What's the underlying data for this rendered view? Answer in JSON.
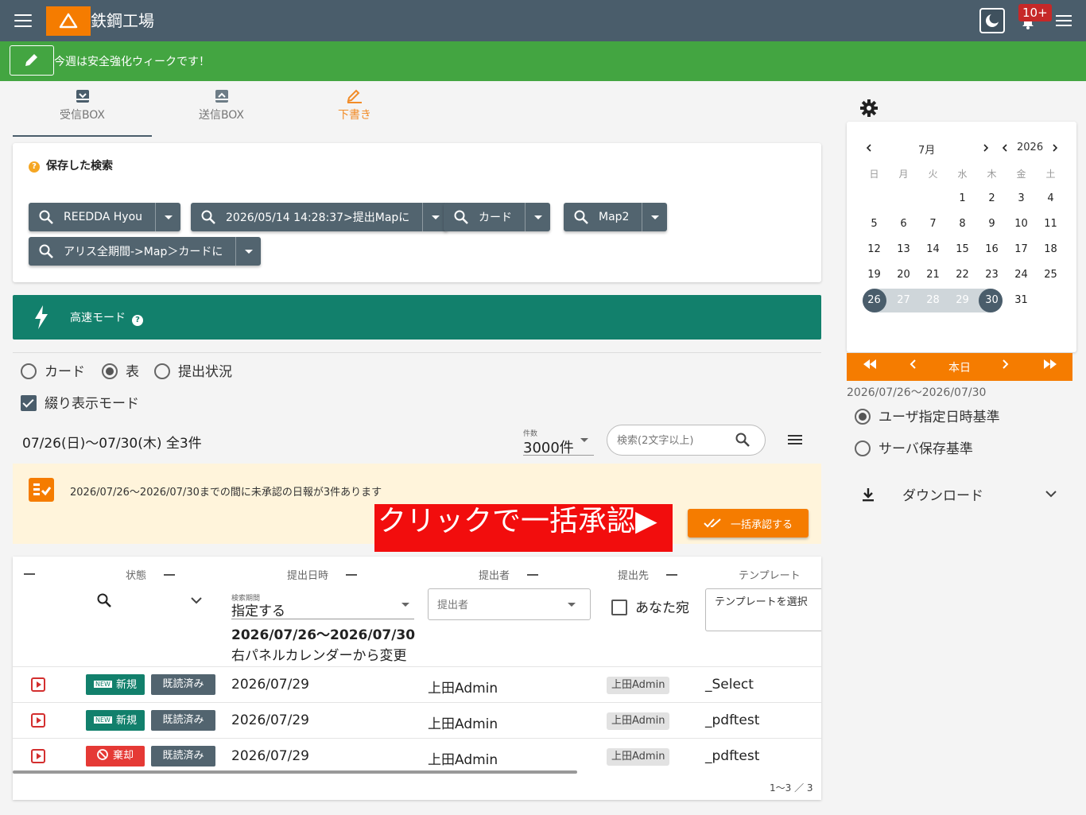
{
  "header": {
    "title": "鉄鋼工場",
    "notification_badge": "10+",
    "theme": {
      "bar": "#4a5d6b",
      "accent": "#f57c00",
      "banner": "#43a541",
      "fast_mode": "#12806c"
    }
  },
  "banner": {
    "text": "今週は安全強化ウィークです！"
  },
  "tabs": [
    {
      "label": "受信BOX",
      "icon": "inbox-icon"
    },
    {
      "label": "送信BOX",
      "icon": "outbox-icon"
    },
    {
      "label": "下書き",
      "icon": "pencil-icon"
    }
  ],
  "saved_search": {
    "title": "保存した検索",
    "chips": [
      "REEDDA Hyou",
      "2026/05/14 14:28:37>提出Mapに",
      "カード",
      "Map2",
      "アリス全期間->Map＞カードに"
    ]
  },
  "fast_mode": {
    "label": "高速モード"
  },
  "view_options": {
    "modes": [
      "カード",
      "表",
      "提出状況"
    ],
    "selected": "表",
    "filter_label": "綴り表示モード",
    "filter_checked": true
  },
  "summary": {
    "range": "07/26(日)〜07/30(木) 全3件",
    "count_label": "件数",
    "count_value": "3000件",
    "search_placeholder": "検索(2文字以上)"
  },
  "notice": {
    "text": "2026/07/26〜2026/07/30までの間に未承認の日報が3件あります",
    "banner_text": "クリックで一括承認▶",
    "approve_button": "一括承認する"
  },
  "table": {
    "headers": [
      "状態",
      "提出日時",
      "提出者",
      "提出先",
      "テンプレート"
    ],
    "filters": {
      "period_label": "検索期間",
      "period_value": "指定する",
      "period_range": "2026/07/26〜2026/07/30",
      "period_hint": "右パネルカレンダーから変更",
      "submitter_placeholder": "提出者",
      "to_me": "あなた宛",
      "template_placeholder": "テンプレートを選択"
    },
    "rows": [
      {
        "status": "新規",
        "status_type": "new",
        "read": "既読済み",
        "date": "2026/07/29",
        "submitter": "上田Admin",
        "to": "上田Admin",
        "template": "_Select"
      },
      {
        "status": "新規",
        "status_type": "new",
        "read": "既読済み",
        "date": "2026/07/29",
        "submitter": "上田Admin",
        "to": "上田Admin",
        "template": "_pdftest"
      },
      {
        "status": "棄却",
        "status_type": "rejected",
        "read": "既読済み",
        "date": "2026/07/29",
        "submitter": "上田Admin",
        "to": "上田Admin",
        "template": "_pdftest"
      }
    ],
    "pagination": "1〜3 ／ 3"
  },
  "calendar": {
    "month": "7月",
    "year": "2026",
    "weekdays": [
      "日",
      "月",
      "火",
      "水",
      "木",
      "金",
      "土"
    ],
    "weeks": [
      [
        "",
        "",
        "",
        "1",
        "2",
        "3",
        "4"
      ],
      [
        "5",
        "6",
        "7",
        "8",
        "9",
        "10",
        "11"
      ],
      [
        "12",
        "13",
        "14",
        "15",
        "16",
        "17",
        "18"
      ],
      [
        "19",
        "20",
        "21",
        "22",
        "23",
        "24",
        "25"
      ],
      [
        "26",
        "27",
        "28",
        "29",
        "30",
        "31",
        ""
      ]
    ],
    "selected_range": [
      "26",
      "30"
    ],
    "today_label": "本日",
    "range_text": "2026/07/26〜2026/07/30"
  },
  "basis": {
    "options": [
      "ユーザ指定日時基準",
      "サーバ保存基準"
    ],
    "selected": "ユーザ指定日時基準"
  },
  "download": {
    "label": "ダウンロード"
  }
}
